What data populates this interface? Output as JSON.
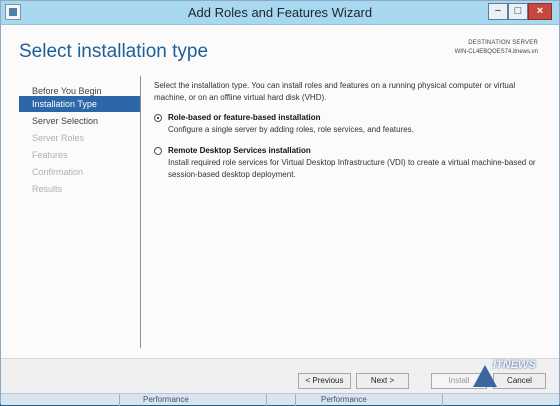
{
  "window": {
    "title": "Add Roles and Features Wizard",
    "controls": {
      "minimize": "−",
      "maximize": "□",
      "close": "×"
    }
  },
  "header": {
    "page_title": "Select installation type",
    "destination_label": "DESTINATION SERVER",
    "destination_server": "WIN-CL4EBQOES74.itnews.vn"
  },
  "sidebar": {
    "items": [
      {
        "label": "Before You Begin",
        "state": "normal"
      },
      {
        "label": "Installation Type",
        "state": "active"
      },
      {
        "label": "Server Selection",
        "state": "normal"
      },
      {
        "label": "Server Roles",
        "state": "disabled"
      },
      {
        "label": "Features",
        "state": "disabled"
      },
      {
        "label": "Confirmation",
        "state": "disabled"
      },
      {
        "label": "Results",
        "state": "disabled"
      }
    ]
  },
  "content": {
    "intro": "Select the installation type. You can install roles and features on a running physical computer or virtual machine, or on an offline virtual hard disk (VHD).",
    "options": [
      {
        "label": "Role-based or feature-based installation",
        "description": "Configure a single server by adding roles, role services, and features.",
        "selected": true
      },
      {
        "label": "Remote Desktop Services installation",
        "description": "Install required role services for Virtual Desktop Infrastructure (VDI) to create a virtual machine-based or session-based desktop deployment.",
        "selected": false
      }
    ]
  },
  "footer": {
    "previous": "< Previous",
    "next": "Next >",
    "install": "Install",
    "cancel": "Cancel"
  },
  "overlay": {
    "watermark": "ITNEWS"
  },
  "background": {
    "performance_left": "Performance",
    "performance_right": "Performance"
  },
  "colors": {
    "title_bar": "#a7d8f0",
    "accent": "#2c68a9",
    "page_title": "#1f5f98",
    "close_button": "#c9483e"
  }
}
